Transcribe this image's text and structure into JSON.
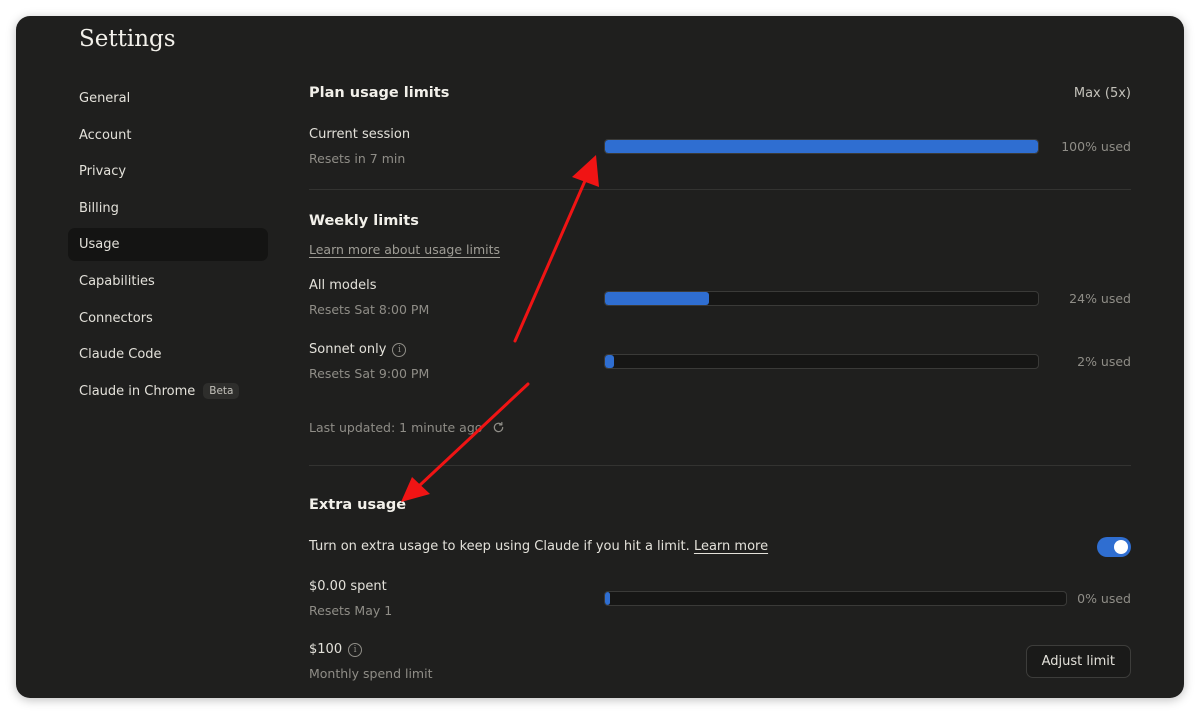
{
  "window": {
    "title": "Settings"
  },
  "sidebar": {
    "items": [
      {
        "label": "General",
        "active": false
      },
      {
        "label": "Account",
        "active": false
      },
      {
        "label": "Privacy",
        "active": false
      },
      {
        "label": "Billing",
        "active": false
      },
      {
        "label": "Usage",
        "active": true
      },
      {
        "label": "Capabilities",
        "active": false
      },
      {
        "label": "Connectors",
        "active": false
      },
      {
        "label": "Claude Code",
        "active": false
      },
      {
        "label": "Claude in Chrome",
        "active": false,
        "badge": "Beta"
      }
    ]
  },
  "plan": {
    "heading": "Plan usage limits",
    "plan_name": "Max (5x)",
    "current_session": {
      "label": "Current session",
      "resets": "Resets in 7 min",
      "percent": 100,
      "percent_text": "100% used"
    }
  },
  "weekly": {
    "heading": "Weekly limits",
    "learn_more": "Learn more about usage limits",
    "all_models": {
      "label": "All models",
      "resets": "Resets Sat 8:00 PM",
      "percent": 24,
      "percent_text": "24% used"
    },
    "sonnet": {
      "label": "Sonnet only",
      "resets": "Resets Sat 9:00 PM",
      "percent": 2,
      "percent_text": "2% used"
    },
    "last_updated": "Last updated: 1 minute ago"
  },
  "extra": {
    "heading": "Extra usage",
    "description": "Turn on extra usage to keep using Claude if you hit a limit.",
    "learn_more": "Learn more",
    "toggle_on": true,
    "spent": {
      "label": "$0.00 spent",
      "resets": "Resets May 1",
      "percent": 0,
      "percent_text": "0% used"
    },
    "limit": {
      "label": "$100",
      "sub": "Monthly spend limit",
      "button": "Adjust limit"
    }
  },
  "colors": {
    "accent": "#2f6ed1",
    "annotation_arrow": "#f01414",
    "background": "#1f1f1e"
  },
  "icons": [
    "info-icon",
    "refresh-icon"
  ]
}
